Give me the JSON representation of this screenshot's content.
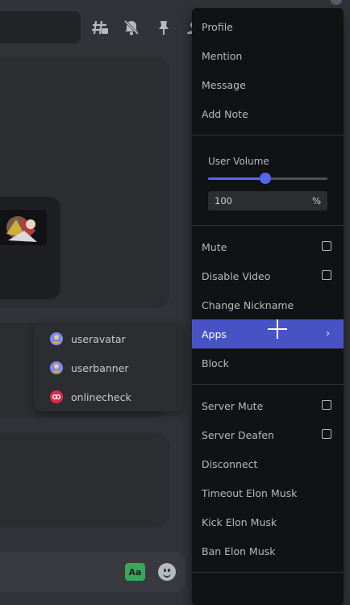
{
  "header": {
    "icons": [
      "threads-icon",
      "bell-mute-icon",
      "pin-icon",
      "members-icon"
    ]
  },
  "apps_popout": {
    "items": [
      {
        "label": "useravatar",
        "icon": "avatar-icon"
      },
      {
        "label": "userbanner",
        "icon": "avatar-icon"
      },
      {
        "label": "onlinecheck",
        "icon": "onlinecheck-icon"
      }
    ]
  },
  "composer": {
    "text_format_label": "Aa"
  },
  "context_menu": {
    "items_top": [
      "Profile",
      "Mention",
      "Message",
      "Add Note"
    ],
    "user_volume": {
      "label": "User Volume",
      "value": "100",
      "unit": "%",
      "slider_fraction": 0.48
    },
    "mute": "Mute",
    "disable_video": "Disable Video",
    "change_nickname": "Change Nickname",
    "apps": "Apps",
    "block": "Block",
    "server_mute": "Server Mute",
    "server_deafen": "Server Deafen",
    "disconnect": "Disconnect",
    "timeout": "Timeout Elon Musk",
    "kick": "Kick Elon Musk",
    "ban": "Ban Elon Musk"
  },
  "colors": {
    "accent": "#5865f2",
    "active_item": "#4752c4",
    "menu_bg": "#111214",
    "app_bg": "#313338"
  }
}
